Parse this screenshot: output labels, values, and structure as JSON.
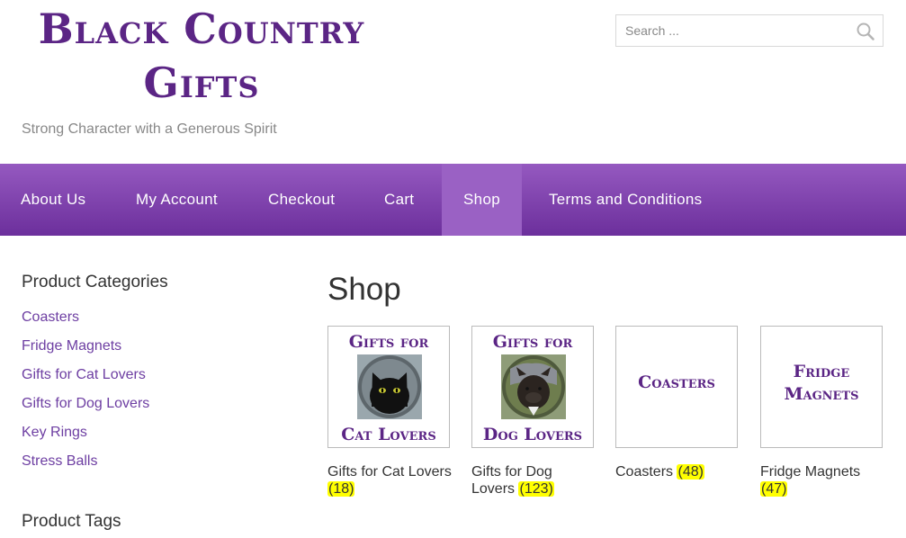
{
  "site": {
    "title_line1": "Black Country",
    "title_line2": "Gifts",
    "tagline": "Strong Character with a Generous Spirit"
  },
  "search": {
    "placeholder": "Search ..."
  },
  "nav": {
    "items": [
      {
        "label": "About Us"
      },
      {
        "label": "My Account"
      },
      {
        "label": "Checkout"
      },
      {
        "label": "Cart"
      },
      {
        "label": "Shop",
        "active": true
      },
      {
        "label": "Terms and Conditions"
      }
    ]
  },
  "sidebar": {
    "categories_title": "Product Categories",
    "categories": [
      {
        "label": "Coasters"
      },
      {
        "label": "Fridge Magnets"
      },
      {
        "label": "Gifts for Cat Lovers"
      },
      {
        "label": "Gifts for Dog Lovers"
      },
      {
        "label": "Key Rings"
      },
      {
        "label": "Stress Balls"
      }
    ],
    "tags_title": "Product Tags"
  },
  "main": {
    "title": "Shop",
    "products": [
      {
        "thumb_top": "Gifts for",
        "thumb_bottom": "Cat Lovers",
        "name": "Gifts for Cat Lovers",
        "count": "(18)"
      },
      {
        "thumb_top": "Gifts for",
        "thumb_bottom": "Dog Lovers",
        "name": "Gifts for Dog Lovers",
        "count": "(123)"
      },
      {
        "thumb_text": "Coasters",
        "name": "Coasters",
        "count": "(48)"
      },
      {
        "thumb_line1": "Fridge",
        "thumb_line2": "Magnets",
        "name": "Fridge Magnets",
        "count": "(47)"
      }
    ]
  },
  "colors": {
    "brand_purple": "#5b2585",
    "nav_gradient_top": "#9559c0",
    "nav_gradient_bottom": "#6c2f9c",
    "nav_active": "#9a61c4",
    "link": "#6d3ea2",
    "count_highlight": "#ffff00"
  }
}
